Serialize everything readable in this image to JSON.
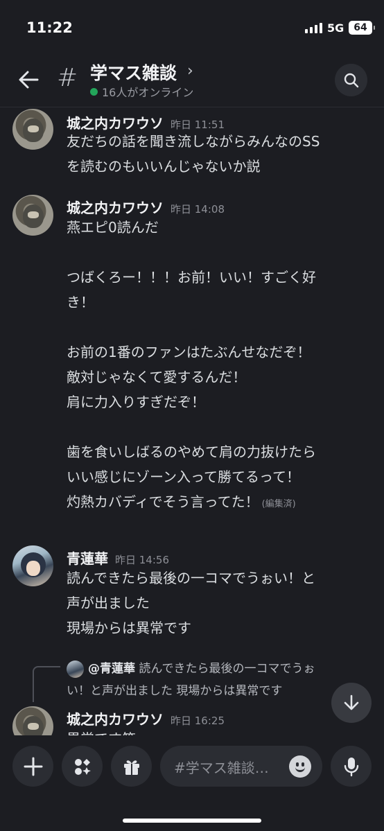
{
  "status_bar": {
    "time": "11:22",
    "network": "5G",
    "battery": "64"
  },
  "header": {
    "title": "学マス雑談",
    "online_text": "16人がオンライン"
  },
  "messages": [
    {
      "author": "城之内カワウソ",
      "timestamp": "昨日 11:51",
      "lines": [
        "友だちの話を聞き流しながらみんなのSS",
        "を読むのもいいんじゃないか説"
      ]
    },
    {
      "author": "城之内カワウソ",
      "timestamp": "昨日 14:08",
      "lines": [
        "燕エピ0読んだ",
        "",
        "つばくろー！！！お前！いい！すごく好",
        "き！",
        "",
        "お前の1番のファンはたぶんせなだぞ！",
        "敵対じゃなくて愛するんだ！",
        "肩に力入りすぎだぞ！",
        "",
        "歯を食いしばるのやめて肩の力抜けたら",
        "いい感じにゾーン入って勝てるって！",
        "灼熱カバディでそう言ってた！"
      ],
      "edited_label": "(編集済)"
    },
    {
      "author": "青蓮華",
      "timestamp": "昨日 14:56",
      "lines": [
        "読んできたら最後の一コマでうぉい！と",
        "声が出ました",
        "現場からは異常です"
      ]
    },
    {
      "reply_to_name": "@青蓮華",
      "reply_line1": "読んできたら最後の一コマでうぉ",
      "reply_line2": "い！と声が出ました 現場からは異常です",
      "author": "城之内カワウソ",
      "timestamp": "昨日 16:25",
      "lines": [
        "異常です笑"
      ]
    }
  ],
  "composer": {
    "placeholder": "#学マス雑談…"
  }
}
